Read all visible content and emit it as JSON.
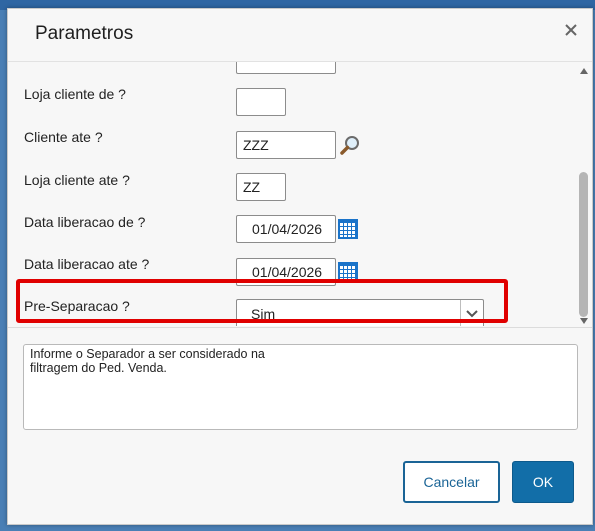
{
  "dialog": {
    "title": "Parametros",
    "close_icon": "close-icon"
  },
  "params": [
    {
      "label": "Loja cliente de ?",
      "value": "",
      "icon": null
    },
    {
      "label": "Cliente ate ?",
      "value": "ZZZ",
      "icon": "search-icon"
    },
    {
      "label": "Loja cliente ate ?",
      "value": "ZZ",
      "icon": null
    },
    {
      "label": "Data liberacao de ?",
      "value": "01/04/2026",
      "icon": "calendar-icon"
    },
    {
      "label": "Data liberacao ate ?",
      "value": "01/04/2026",
      "icon": "calendar-icon"
    }
  ],
  "preseparacao": {
    "label": "Pre-Separacao ?",
    "selected": "Sim"
  },
  "help_text": "Informe o Separador  a ser considerado na\nfiltragem do Ped. Venda.",
  "buttons": {
    "cancel": "Cancelar",
    "ok": "OK"
  },
  "colors": {
    "accent": "#126ea8",
    "highlight": "#e00000"
  }
}
